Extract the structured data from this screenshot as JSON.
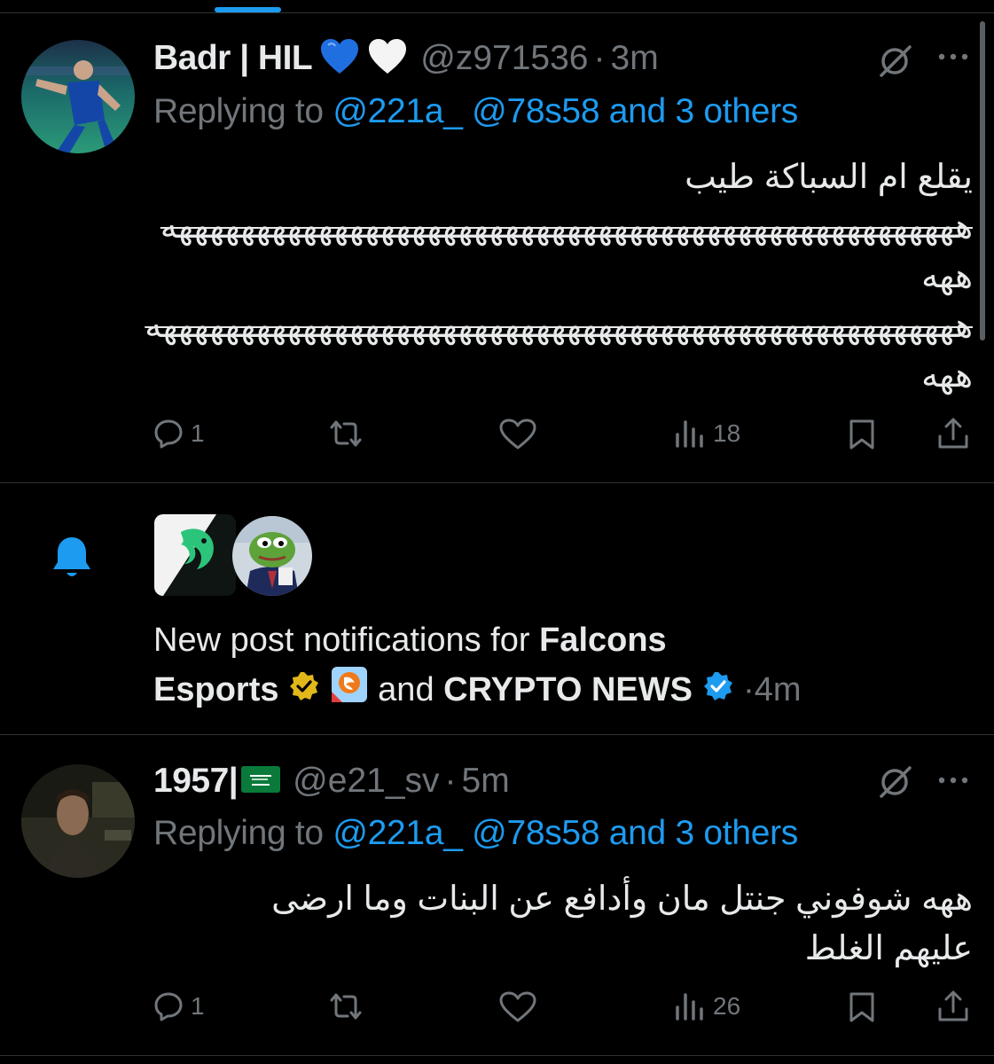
{
  "tweets": [
    {
      "display_name": "Badr | HIL",
      "handle": "@z971536",
      "dot": "·",
      "time": "3m",
      "replying_prefix": "Replying to ",
      "mention1": "@221a_",
      "mention2": "@78s58",
      "others": "and 3 others",
      "lines": [
        "يقلع ام السباكة طيب",
        "هههههههههههههههههههههههههههههههههههههههههههههههههههه",
        "ههه",
        "ههههههههههههههههههههههههههههههههههههههههههههههههههههه",
        "ههه"
      ],
      "replies": "1",
      "views": "18"
    },
    {
      "display_name": "1957|",
      "handle": "@e21_sv",
      "dot": "·",
      "time": "5m",
      "replying_prefix": "Replying to ",
      "mention1": "@221a_",
      "mention2": "@78s58",
      "others": "and 3 others",
      "lines": [
        "ههه شوفوني جنتل مان وأدافع عن البنات وما ارضى",
        "عليهم الغلط"
      ],
      "replies": "1",
      "views": "26"
    }
  ],
  "notification": {
    "prefix": "New post notifications for ",
    "account1": "Falcons",
    "account1b": "Esports",
    "joiner": "and",
    "account2": "CRYPTO NEWS",
    "dot": "·",
    "time": "4m"
  },
  "colors": {
    "background": "#000000",
    "link": "#1d9bf0",
    "muted": "#71767b",
    "text": "#e7e9ea",
    "divider": "#2f3336"
  },
  "icons": [
    "blue-heart-icon",
    "white-heart-icon",
    "grok-icon",
    "more-icon",
    "reply-icon",
    "retweet-icon",
    "like-icon",
    "views-icon",
    "bookmark-icon",
    "share-icon",
    "bell-icon",
    "verified-gold-icon",
    "verified-blue-icon",
    "saudi-flag-icon"
  ]
}
